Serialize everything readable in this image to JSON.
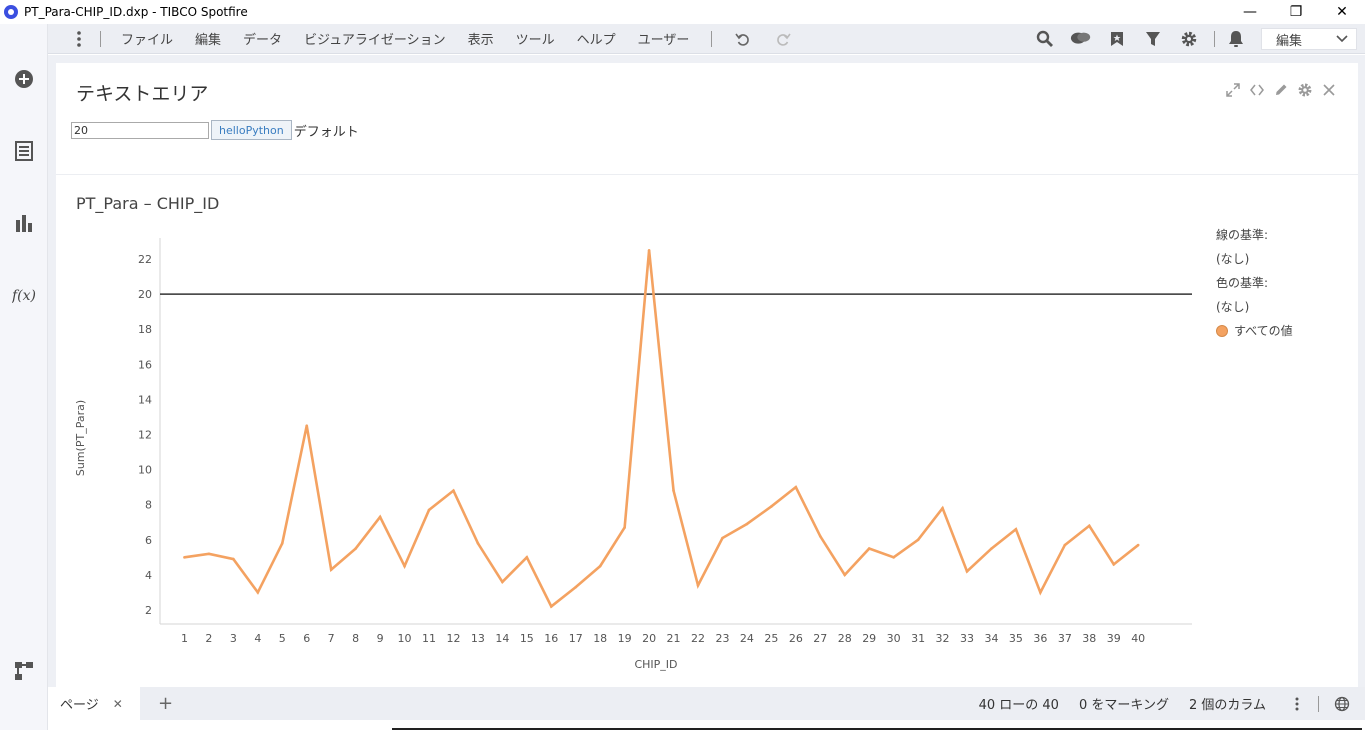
{
  "window": {
    "title": "PT_Para-CHIP_ID.dxp - TIBCO Spotfire",
    "minimize": "—",
    "restore": "❐",
    "close": "✕"
  },
  "menu": {
    "items": [
      "ファイル",
      "編集",
      "データ",
      "ビジュアライゼーション",
      "表示",
      "ツール",
      "ヘルプ",
      "ユーザー"
    ],
    "mode_dropdown": "編集"
  },
  "text_area": {
    "title": "テキストエリア",
    "input_value": "20",
    "button_label": "helloPython",
    "default_label": "デフォルト"
  },
  "chart_data": {
    "type": "line",
    "title": "PT_Para – CHIP_ID",
    "xlabel": "CHIP_ID",
    "ylabel": "Sum(PT_Para)",
    "x": [
      1,
      2,
      3,
      4,
      5,
      6,
      7,
      8,
      9,
      10,
      11,
      12,
      13,
      14,
      15,
      16,
      17,
      18,
      19,
      20,
      21,
      22,
      23,
      24,
      25,
      26,
      27,
      28,
      29,
      30,
      31,
      32,
      33,
      34,
      35,
      36,
      37,
      38,
      39,
      40
    ],
    "series": [
      {
        "name": "すべての値",
        "color": "#f4a261",
        "values": [
          5.0,
          5.2,
          4.9,
          3.0,
          5.8,
          12.5,
          4.3,
          5.5,
          7.3,
          4.5,
          7.7,
          8.8,
          5.8,
          3.6,
          5.0,
          2.2,
          3.3,
          4.5,
          6.7,
          22.5,
          8.8,
          3.4,
          6.1,
          6.9,
          7.9,
          9.0,
          6.2,
          4.0,
          5.5,
          5.0,
          6.0,
          7.8,
          4.2,
          5.5,
          6.6,
          3.0,
          5.7,
          6.8,
          4.6,
          5.7
        ]
      }
    ],
    "reference_line": {
      "value": 20,
      "color": "#333333"
    },
    "yticks": [
      2,
      4,
      6,
      8,
      10,
      12,
      14,
      16,
      18,
      20,
      22
    ],
    "ylim": [
      1.2,
      23.2
    ],
    "xlim": [
      0,
      42.2
    ],
    "grid": false,
    "legend_position": "right"
  },
  "legend": {
    "line_by_label": "線の基準:",
    "line_by_value": "(なし)",
    "color_by_label": "色の基準:",
    "color_by_value": "(なし)",
    "series_label": "すべての値"
  },
  "status": {
    "page_tab": "ページ",
    "rows": "40 ローの 40",
    "marking": "0 をマーキング",
    "columns": "2 個のカラム"
  }
}
